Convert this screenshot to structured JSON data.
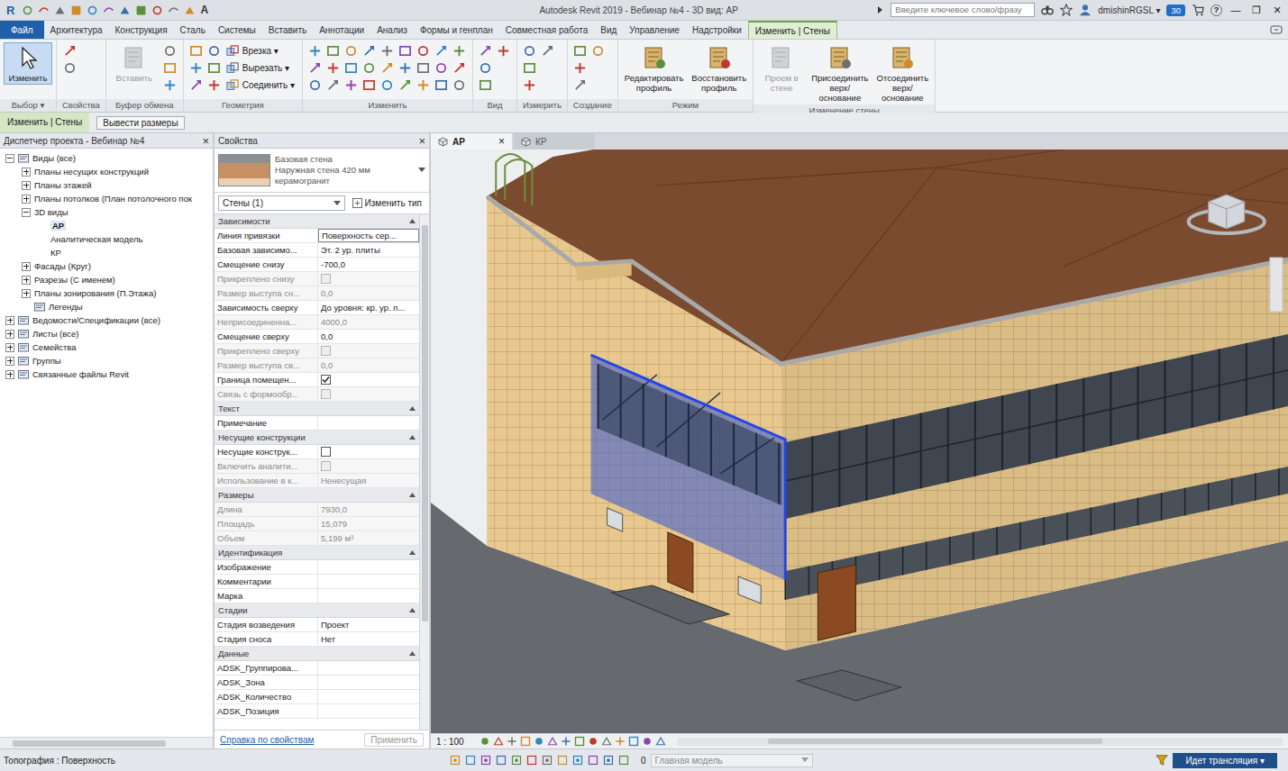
{
  "window": {
    "logo": "R",
    "title": "Autodesk Revit 2019 - Вебинар №4 - 3D вид: АР",
    "search_placeholder": "Введите ключевое слово/фразу",
    "text_tool": "A",
    "user": "dmishinRGSL",
    "user_menu": "▾",
    "badge": "30",
    "help": "?",
    "controls": [
      "—",
      "❐",
      "✕"
    ]
  },
  "ribbon_tabs": [
    {
      "label": "Файл",
      "kind": "file",
      "selected": false
    },
    {
      "label": "Архитектура",
      "kind": "tab",
      "selected": false
    },
    {
      "label": "Конструкция",
      "kind": "tab",
      "selected": false
    },
    {
      "label": "Сталь",
      "kind": "tab",
      "selected": false
    },
    {
      "label": "Системы",
      "kind": "tab",
      "selected": false
    },
    {
      "label": "Вставить",
      "kind": "tab",
      "selected": false
    },
    {
      "label": "Аннотации",
      "kind": "tab",
      "selected": false
    },
    {
      "label": "Анализ",
      "kind": "tab",
      "selected": false
    },
    {
      "label": "Формы и генплан",
      "kind": "tab",
      "selected": false
    },
    {
      "label": "Совместная работа",
      "kind": "tab",
      "selected": false
    },
    {
      "label": "Вид",
      "kind": "tab",
      "selected": false
    },
    {
      "label": "Управление",
      "kind": "tab",
      "selected": false
    },
    {
      "label": "Надстройки",
      "kind": "tab",
      "selected": false
    },
    {
      "label": "Изменить | Стены",
      "kind": "context",
      "selected": true
    }
  ],
  "ribbon_groups": [
    {
      "label": "Выбор ▾",
      "tools": [
        {
          "label": "Изменить",
          "kind": "large",
          "selected": true,
          "disabled": false
        }
      ]
    },
    {
      "label": "Свойства",
      "tools": []
    },
    {
      "label": "Буфер обмена",
      "tools": [
        {
          "label": "Вставить",
          "kind": "large",
          "selected": false,
          "disabled": true
        }
      ]
    },
    {
      "label": "Геометрия",
      "tools": [
        {
          "label": "Врезка ▾",
          "kind": "small",
          "selected": false,
          "disabled": false
        },
        {
          "label": "Вырезать ▾",
          "kind": "small",
          "selected": false,
          "disabled": false
        },
        {
          "label": "Соединить ▾",
          "kind": "small",
          "selected": false,
          "disabled": false
        }
      ]
    },
    {
      "label": "Изменить",
      "tools": []
    },
    {
      "label": "Вид",
      "tools": []
    },
    {
      "label": "Измерить",
      "tools": []
    },
    {
      "label": "Создание",
      "tools": []
    },
    {
      "label": "Режим",
      "tools": [
        {
          "label": "Редактировать профиль",
          "kind": "large",
          "selected": false,
          "disabled": false
        },
        {
          "label": "Восстановить профиль",
          "kind": "large",
          "selected": false,
          "disabled": false
        }
      ]
    },
    {
      "label": "Изменение стены",
      "tools": [
        {
          "label": "Проем в стене",
          "kind": "large",
          "selected": false,
          "disabled": true
        },
        {
          "label": "Присоединить верх/основание",
          "kind": "large",
          "selected": false,
          "disabled": false
        },
        {
          "label": "Отсоединить верх/основание",
          "kind": "large",
          "selected": false,
          "disabled": false
        }
      ]
    }
  ],
  "context_bar": {
    "label": "Изменить | Стены",
    "buttons": [
      "Вывести размеры"
    ]
  },
  "project_browser": {
    "title": "Диспетчер проекта - Вебинар №4",
    "close": "×",
    "items": [
      {
        "label": "Виды (все)",
        "depth": 0,
        "kind": "node",
        "expanded": true,
        "selected": false
      },
      {
        "label": "Планы несущих конструкций",
        "depth": 1,
        "kind": "node",
        "expanded": false,
        "selected": false
      },
      {
        "label": "Планы этажей",
        "depth": 1,
        "kind": "node",
        "expanded": false,
        "selected": false
      },
      {
        "label": "Планы потолков (План потолочного пок",
        "depth": 1,
        "kind": "node",
        "expanded": false,
        "selected": false
      },
      {
        "label": "3D виды",
        "depth": 1,
        "kind": "node",
        "expanded": true,
        "selected": false
      },
      {
        "label": "АР",
        "depth": 2,
        "kind": "leaf",
        "expanded": false,
        "selected": true
      },
      {
        "label": "Аналитическая модель",
        "depth": 2,
        "kind": "leaf",
        "expanded": false,
        "selected": false
      },
      {
        "label": "КР",
        "depth": 2,
        "kind": "leaf",
        "expanded": false,
        "selected": false
      },
      {
        "label": "Фасады (Круг)",
        "depth": 1,
        "kind": "node",
        "expanded": false,
        "selected": false
      },
      {
        "label": "Разрезы (С именем)",
        "depth": 1,
        "kind": "node",
        "expanded": false,
        "selected": false
      },
      {
        "label": "Планы зонирования (П.Этажа)",
        "depth": 1,
        "kind": "node",
        "expanded": false,
        "selected": false
      },
      {
        "label": "Легенды",
        "depth": 1,
        "kind": "leaf",
        "expanded": false,
        "selected": false
      },
      {
        "label": "Ведомости/Спецификации (все)",
        "depth": 0,
        "kind": "node",
        "expanded": false,
        "selected": false
      },
      {
        "label": "Листы (все)",
        "depth": 0,
        "kind": "node",
        "expanded": false,
        "selected": false
      },
      {
        "label": "Семейства",
        "depth": 0,
        "kind": "node",
        "expanded": false,
        "selected": false
      },
      {
        "label": "Группы",
        "depth": 0,
        "kind": "node",
        "expanded": false,
        "selected": false
      },
      {
        "label": "Связанные файлы Revit",
        "depth": 0,
        "kind": "node",
        "expanded": false,
        "selected": false
      }
    ]
  },
  "properties": {
    "title": "Свойства",
    "close": "×",
    "type": {
      "lines": [
        "Базовая стена",
        "Наружная стена 420 мм",
        "керамогранит"
      ]
    },
    "instance": {
      "label": "Стены (1)",
      "edit_type": "Изменить тип"
    },
    "groups": [
      {
        "title": "Зависимости",
        "rows": [
          {
            "name": "Линия привязки",
            "kind": "text",
            "value": "Поверхность сер...",
            "disabled": false,
            "focused": true
          },
          {
            "name": "Базовая зависимо...",
            "kind": "text",
            "value": "Эт. 2 ур. плиты",
            "disabled": false,
            "focused": false
          },
          {
            "name": "Смещение снизу",
            "kind": "text",
            "value": "-700,0",
            "disabled": false,
            "focused": false
          },
          {
            "name": "Прикреплено снизу",
            "kind": "check",
            "checked": false,
            "disabled": true,
            "focused": false
          },
          {
            "name": "Размер выступа сн...",
            "kind": "text",
            "value": "0,0",
            "disabled": true,
            "focused": false
          },
          {
            "name": "Зависимость сверху",
            "kind": "text",
            "value": "До уровня: кр. ур. п...",
            "disabled": false,
            "focused": false
          },
          {
            "name": "Неприсоединенна...",
            "kind": "text",
            "value": "4000,0",
            "disabled": true,
            "focused": false
          },
          {
            "name": "Смещение сверху",
            "kind": "text",
            "value": "0,0",
            "disabled": false,
            "focused": false
          },
          {
            "name": "Прикреплено сверху",
            "kind": "check",
            "checked": false,
            "disabled": true,
            "focused": false
          },
          {
            "name": "Размер выступа св...",
            "kind": "text",
            "value": "0,0",
            "disabled": true,
            "focused": false
          },
          {
            "name": "Граница помещен...",
            "kind": "check",
            "checked": true,
            "disabled": false,
            "focused": false
          },
          {
            "name": "Связь с формообр...",
            "kind": "check",
            "checked": false,
            "disabled": true,
            "focused": false
          }
        ]
      },
      {
        "title": "Текст",
        "rows": [
          {
            "name": "Примечание",
            "kind": "text",
            "value": "",
            "disabled": false,
            "focused": false
          }
        ]
      },
      {
        "title": "Несущие конструкции",
        "rows": [
          {
            "name": "Несущие конструк...",
            "kind": "check",
            "checked": false,
            "disabled": false,
            "focused": false
          },
          {
            "name": "Включить аналити...",
            "kind": "check",
            "checked": false,
            "disabled": true,
            "focused": false
          },
          {
            "name": "Использование в к...",
            "kind": "text",
            "value": "Ненесущая",
            "disabled": true,
            "focused": false
          }
        ]
      },
      {
        "title": "Размеры",
        "rows": [
          {
            "name": "Длина",
            "kind": "text",
            "value": "7930,0",
            "disabled": true,
            "focused": false
          },
          {
            "name": "Площадь",
            "kind": "text",
            "value": "15,079",
            "disabled": true,
            "focused": false
          },
          {
            "name": "Объем",
            "kind": "text",
            "value": "5,199 м³",
            "disabled": true,
            "focused": false
          }
        ]
      },
      {
        "title": "Идентификация",
        "rows": [
          {
            "name": "Изображение",
            "kind": "text",
            "value": "",
            "disabled": false,
            "focused": false
          },
          {
            "name": "Комментарии",
            "kind": "text",
            "value": "",
            "disabled": false,
            "focused": false
          },
          {
            "name": "Марка",
            "kind": "text",
            "value": "",
            "disabled": false,
            "focused": false
          }
        ]
      },
      {
        "title": "Стадии",
        "rows": [
          {
            "name": "Стадия возведения",
            "kind": "text",
            "value": "Проект",
            "disabled": false,
            "focused": false
          },
          {
            "name": "Стадия сноса",
            "kind": "text",
            "value": "Нет",
            "disabled": false,
            "focused": false
          }
        ]
      },
      {
        "title": "Данные",
        "rows": [
          {
            "name": "ADSK_Группирова...",
            "kind": "text",
            "value": "",
            "disabled": false,
            "focused": false
          },
          {
            "name": "ADSK_Зона",
            "kind": "text",
            "value": "",
            "disabled": false,
            "focused": false
          },
          {
            "name": "ADSK_Количество",
            "kind": "text",
            "value": "",
            "disabled": false,
            "focused": false
          },
          {
            "name": "ADSK_Позиция",
            "kind": "text",
            "value": "",
            "disabled": false,
            "focused": false
          }
        ]
      }
    ],
    "help_link": "Справка по свойствам",
    "apply": "Применить",
    "apply_disabled": true
  },
  "view_tabs": [
    {
      "label": "АР",
      "selected": true,
      "close": "×"
    },
    {
      "label": "КР",
      "selected": false,
      "close": ""
    }
  ],
  "view": {
    "scale": "1 : 100"
  },
  "status_bar": {
    "hint": "Топография : Поверхность",
    "selection_count": "0",
    "model": "Главная модель",
    "broadcast": "Идет трансляция",
    "broadcast_menu": "▾"
  }
}
